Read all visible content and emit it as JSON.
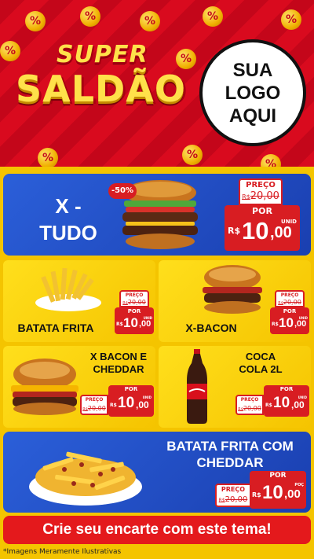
{
  "header": {
    "title_top": "SUPER",
    "title_main": "SALDÃO",
    "logo_lines": [
      "SUA",
      "LOGO",
      "AQUI"
    ]
  },
  "labels": {
    "old_price": "PREÇO",
    "new_price": "POR",
    "currency": "R$",
    "unit": "UNID",
    "unit_short": "POÇ"
  },
  "products": [
    {
      "name": "X - TUDO",
      "discount_badge": "-50%",
      "old_price": "20,00",
      "price_int": "10",
      "price_dec": ",00"
    },
    {
      "name": "BATATA FRITA",
      "old_price": "20,00",
      "price_int": "10",
      "price_dec": ",00"
    },
    {
      "name": "X-BACON",
      "old_price": "20,00",
      "price_int": "10",
      "price_dec": ",00"
    },
    {
      "name": "X BACON E CHEDDAR",
      "old_price": "20,00",
      "price_int": "10",
      "price_dec": ",00"
    },
    {
      "name": "COCA COLA 2L",
      "old_price": "20,00",
      "price_int": "10",
      "price_dec": ",00"
    },
    {
      "name": "BATATA FRITA COM CHEDDAR",
      "old_price": "20,00",
      "price_int": "10",
      "price_dec": ",00"
    }
  ],
  "footer": {
    "cta": "Crie seu encarte com este tema!",
    "disclaimer": "*Imagens Meramente Ilustrativas"
  },
  "colors": {
    "red": "#d81d22",
    "blue": "#2b5fd9",
    "yellow": "#ffd600"
  }
}
